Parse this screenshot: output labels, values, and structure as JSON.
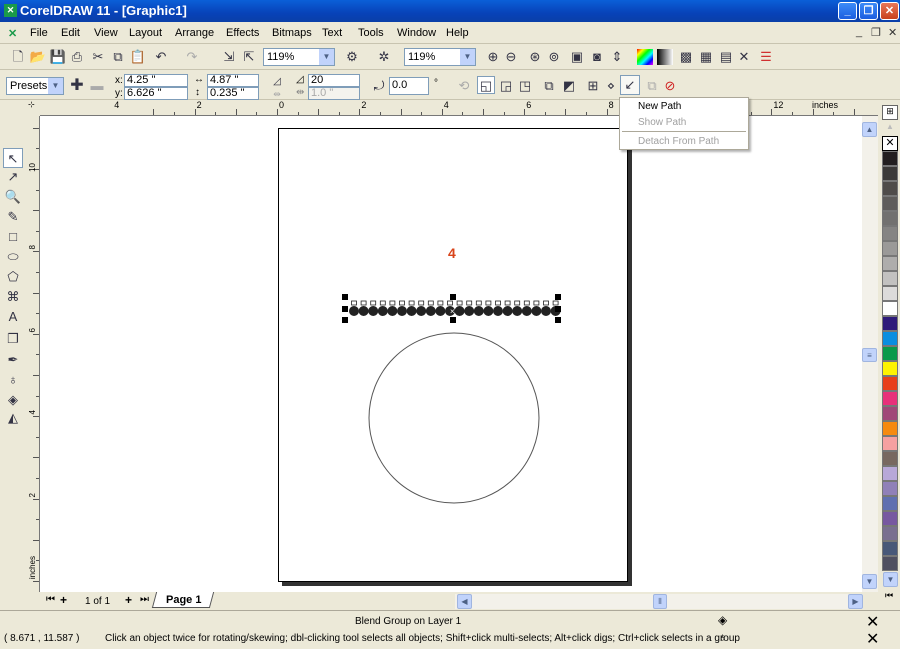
{
  "window": {
    "title": "CorelDRAW 11 - [Graphic1]",
    "app_icon": "corel-icon"
  },
  "menu": [
    "File",
    "Edit",
    "View",
    "Layout",
    "Arrange",
    "Effects",
    "Bitmaps",
    "Text",
    "Tools",
    "Window",
    "Help"
  ],
  "standard_toolbar": {
    "zoom_level_1": "119%",
    "zoom_level_2": "119%"
  },
  "property_bar": {
    "preset": "Presets...",
    "x_label": "x:",
    "x": "4.25 \"",
    "y_label": "y:",
    "y": "6.626 \"",
    "width": "4.87 \"",
    "height": "0.235 \"",
    "steps": "20",
    "spacing": "1.0 \"",
    "rotation": "0.0",
    "degree": "°"
  },
  "path_menu": {
    "items": [
      {
        "label": "New Path",
        "enabled": true
      },
      {
        "label": "Show Path",
        "enabled": false
      },
      {
        "label": "Detach From Path",
        "enabled": false
      }
    ]
  },
  "rulers": {
    "horizontal": [
      "4",
      "2",
      "0",
      "2",
      "4",
      "6",
      "8",
      "12"
    ],
    "unit": "inches",
    "vertical": [
      "10",
      "8",
      "6",
      "4",
      "2"
    ]
  },
  "canvas": {
    "annotation": "4",
    "annotation_color": "#d9441a"
  },
  "palette": [
    "#231f20",
    "#3c3a38",
    "#4f4c4a",
    "#5f5d5b",
    "#727170",
    "#858483",
    "#9a9998",
    "#aeadac",
    "#c2c1c0",
    "#dcdbda",
    "#ffffff",
    "#2e1a7a",
    "#0a8ee0",
    "#0a9a4a",
    "#fff200",
    "#e8401a",
    "#e8307a",
    "#a04878",
    "#f58a10",
    "#f5a0a0",
    "#786860",
    "#b8a8d8",
    "#9080b8",
    "#6070b0",
    "#7858a0",
    "#7a7090",
    "#485878",
    "#505060"
  ],
  "page_nav": {
    "count": "1 of 1",
    "tab": "Page 1"
  },
  "status": {
    "object": "Blend Group on Layer 1",
    "coords": "( 8.671 , 11.587 )",
    "hint": "Click an object twice for rotating/skewing; dbl-clicking tool selects all objects; Shift+click multi-selects; Alt+click digs; Ctrl+click selects in a group"
  }
}
